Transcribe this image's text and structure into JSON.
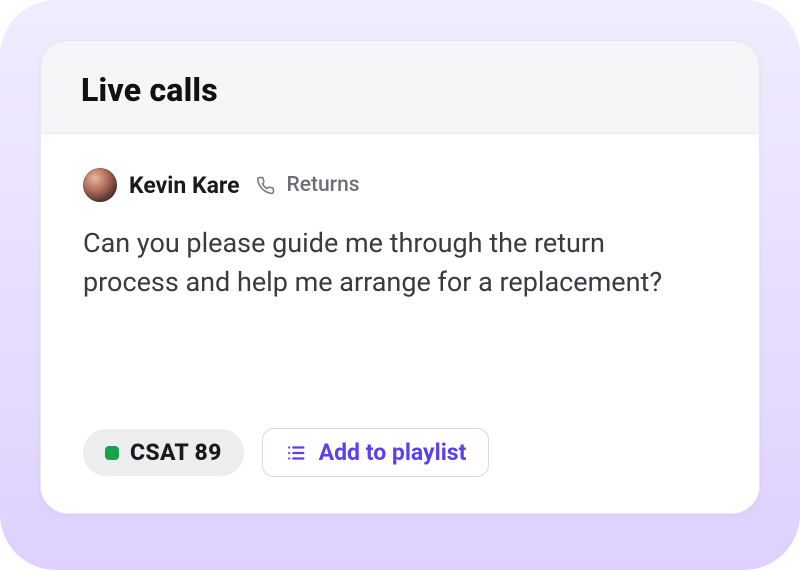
{
  "header": {
    "title": "Live calls"
  },
  "call": {
    "caller_name": "Kevin Kare",
    "topic": "Returns",
    "message": "Can you please guide me through the return process and help me arrange for a replacement?"
  },
  "csat": {
    "label": "CSAT 89",
    "status_color": "#16a34a"
  },
  "actions": {
    "add_to_playlist_label": "Add to playlist"
  },
  "colors": {
    "accent": "#5a3ff3"
  }
}
